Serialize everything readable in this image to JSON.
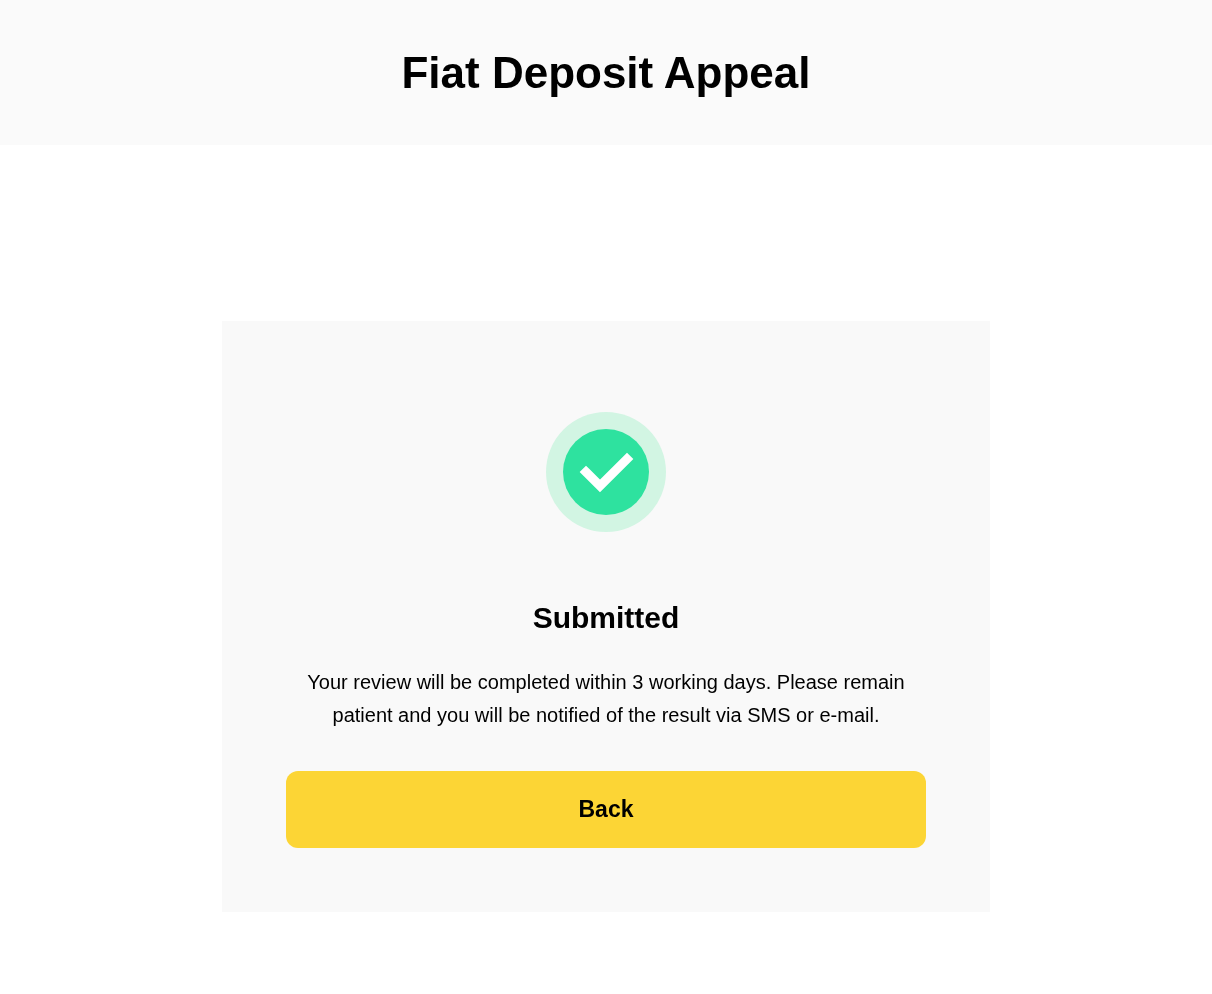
{
  "header": {
    "title": "Fiat Deposit Appeal"
  },
  "result": {
    "kind": "success",
    "title": "Submitted",
    "message": "Your review will be completed within 3 working days. Please remain patient and you will be notified of the result via SMS or e-mail.",
    "button": "Back"
  }
}
